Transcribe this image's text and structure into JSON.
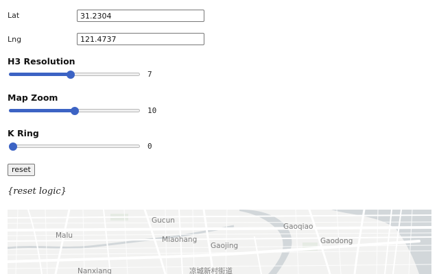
{
  "form": {
    "lat": {
      "label": "Lat",
      "value": "31.2304"
    },
    "lng": {
      "label": "Lng",
      "value": "121.4737"
    }
  },
  "sliders": {
    "h3_resolution": {
      "label": "H3 Resolution",
      "value": "7",
      "fraction": 0.47
    },
    "map_zoom": {
      "label": "Map Zoom",
      "value": "10",
      "fraction": 0.5
    },
    "k_ring": {
      "label": "K Ring",
      "value": "0",
      "fraction": 0.0
    }
  },
  "reset_label": "reset",
  "reset_logic_text": "{reset logic}",
  "map": {
    "labels": {
      "malu": "Malu",
      "gucun": "Gucun",
      "miaohang": "Miaohang",
      "gaojing": "Gaojing",
      "gaoqiao": "Gaoqiao",
      "gaodong": "Gaodong",
      "nanxiang": "Nanxiang",
      "liangcheng": "凉城新村街道"
    },
    "colors": {
      "land": "#f2f2f1",
      "water": "#d2d7da",
      "roads": "#ffffff",
      "accent": "#3c63c4"
    }
  }
}
